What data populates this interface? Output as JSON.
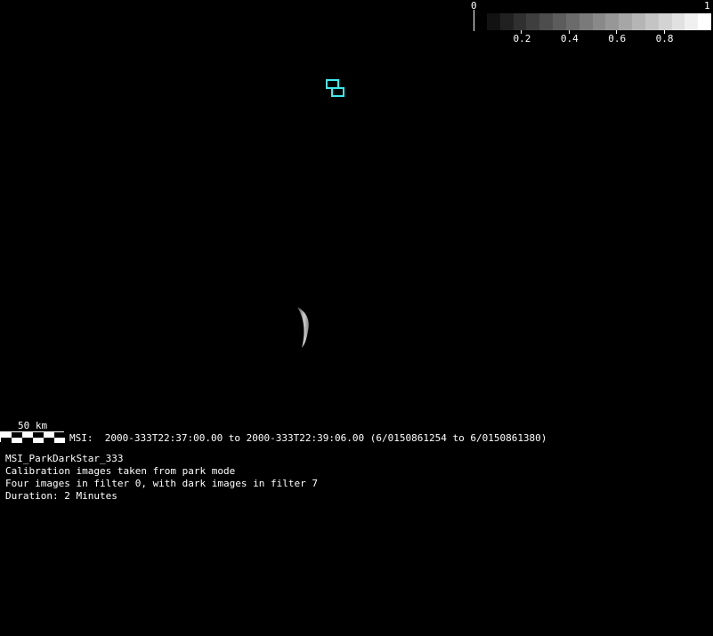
{
  "colorbar": {
    "min_label": "0",
    "max_label": "1",
    "tick_labels": [
      "0.2",
      "0.4",
      "0.6",
      "0.8"
    ],
    "ticks": [
      0.2,
      0.4,
      0.6,
      0.8
    ],
    "steps": 17
  },
  "overlay": {
    "footprint_color": "#3ee8ee"
  },
  "scalebar": {
    "label": "50 km"
  },
  "observation": {
    "time_line": "MSI:  2000-333T22:37:00.00 to 2000-333T22:39:06.00 (6/0150861254 to 6/0150861380)",
    "name": "MSI_ParkDarkStar_333",
    "description_lines": [
      "Calibration images taken from park mode",
      "Four images in filter 0, with dark images in filter 7",
      "Duration: 2 Minutes"
    ]
  }
}
